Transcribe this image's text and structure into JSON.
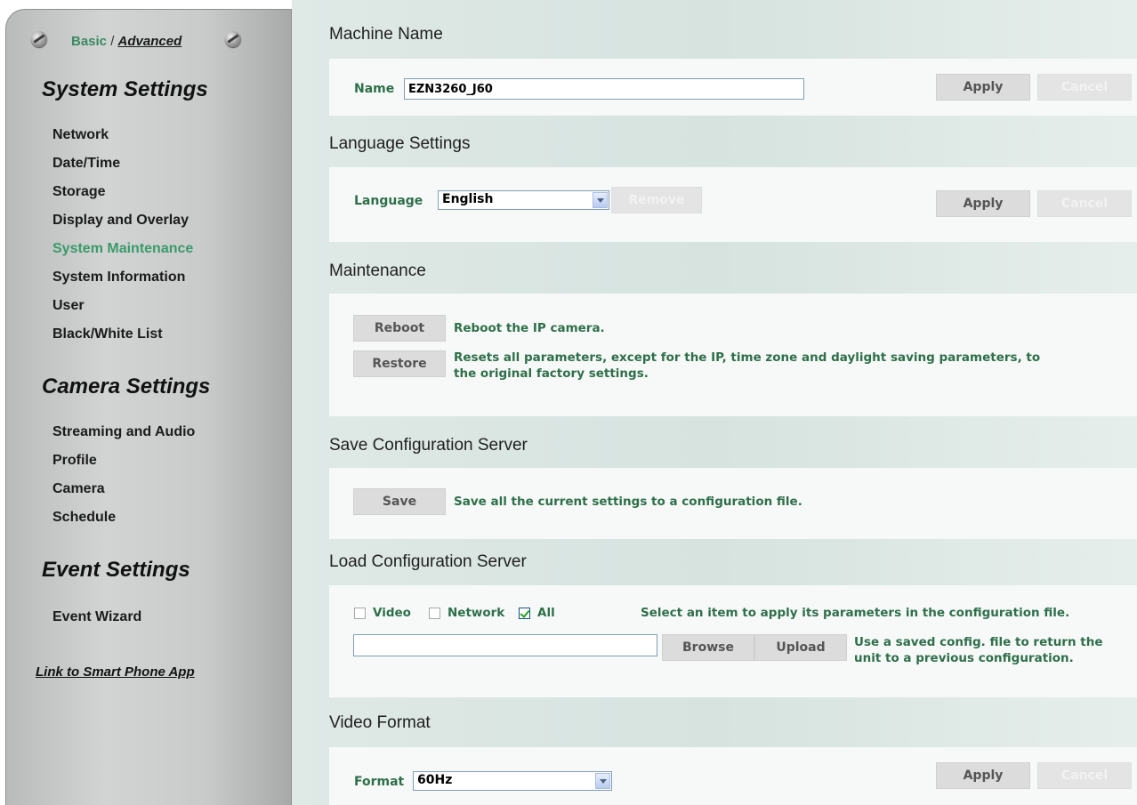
{
  "sidebar": {
    "mode": {
      "basic": "Basic",
      "separator": "/",
      "advanced": "Advanced"
    },
    "sections": [
      {
        "title": "System Settings",
        "items": [
          "Network",
          "Date/Time",
          "Storage",
          "Display and Overlay",
          "System Maintenance",
          "System Information",
          "User",
          "Black/White List"
        ]
      },
      {
        "title": "Camera Settings",
        "items": [
          "Streaming and Audio",
          "Profile",
          "Camera",
          "Schedule"
        ]
      },
      {
        "title": "Event Settings",
        "items": [
          "Event Wizard"
        ]
      }
    ],
    "active_item": "System Maintenance",
    "phone_link": "Link to Smart Phone App"
  },
  "machine_name": {
    "header": "Machine Name",
    "label": "Name",
    "value": "EZN3260_J60",
    "apply": "Apply",
    "cancel": "Cancel"
  },
  "language": {
    "header": "Language Settings",
    "label": "Language",
    "selected": "English",
    "remove": "Remove",
    "apply": "Apply",
    "cancel": "Cancel"
  },
  "maintenance": {
    "header": "Maintenance",
    "reboot_button": "Reboot",
    "reboot_desc": "Reboot the IP camera.",
    "restore_button": "Restore",
    "restore_desc_line1": "Resets all parameters, except for the IP, time zone and daylight saving parameters, to",
    "restore_desc_line2": "the original factory settings."
  },
  "save_config": {
    "header": "Save Configuration Server",
    "button": "Save",
    "desc": "Save all the current settings to a configuration file."
  },
  "load_config": {
    "header": "Load Configuration Server",
    "checkboxes": [
      {
        "label": "Video",
        "checked": false
      },
      {
        "label": "Network",
        "checked": false
      },
      {
        "label": "All",
        "checked": true
      }
    ],
    "select_desc": "Select an item to apply its parameters in the configuration file.",
    "file_value": "",
    "browse": "Browse",
    "upload": "Upload",
    "upload_desc_line1": "Use a saved config. file to return the",
    "upload_desc_line2": "unit to a previous configuration."
  },
  "video_format": {
    "header": "Video Format",
    "label": "Format",
    "selected": "60Hz",
    "apply": "Apply",
    "cancel": "Cancel"
  },
  "colors": {
    "accent_green": "#2e6f4a",
    "active_nav": "#3a9a6a",
    "panel_bg": "#d6e3df"
  }
}
